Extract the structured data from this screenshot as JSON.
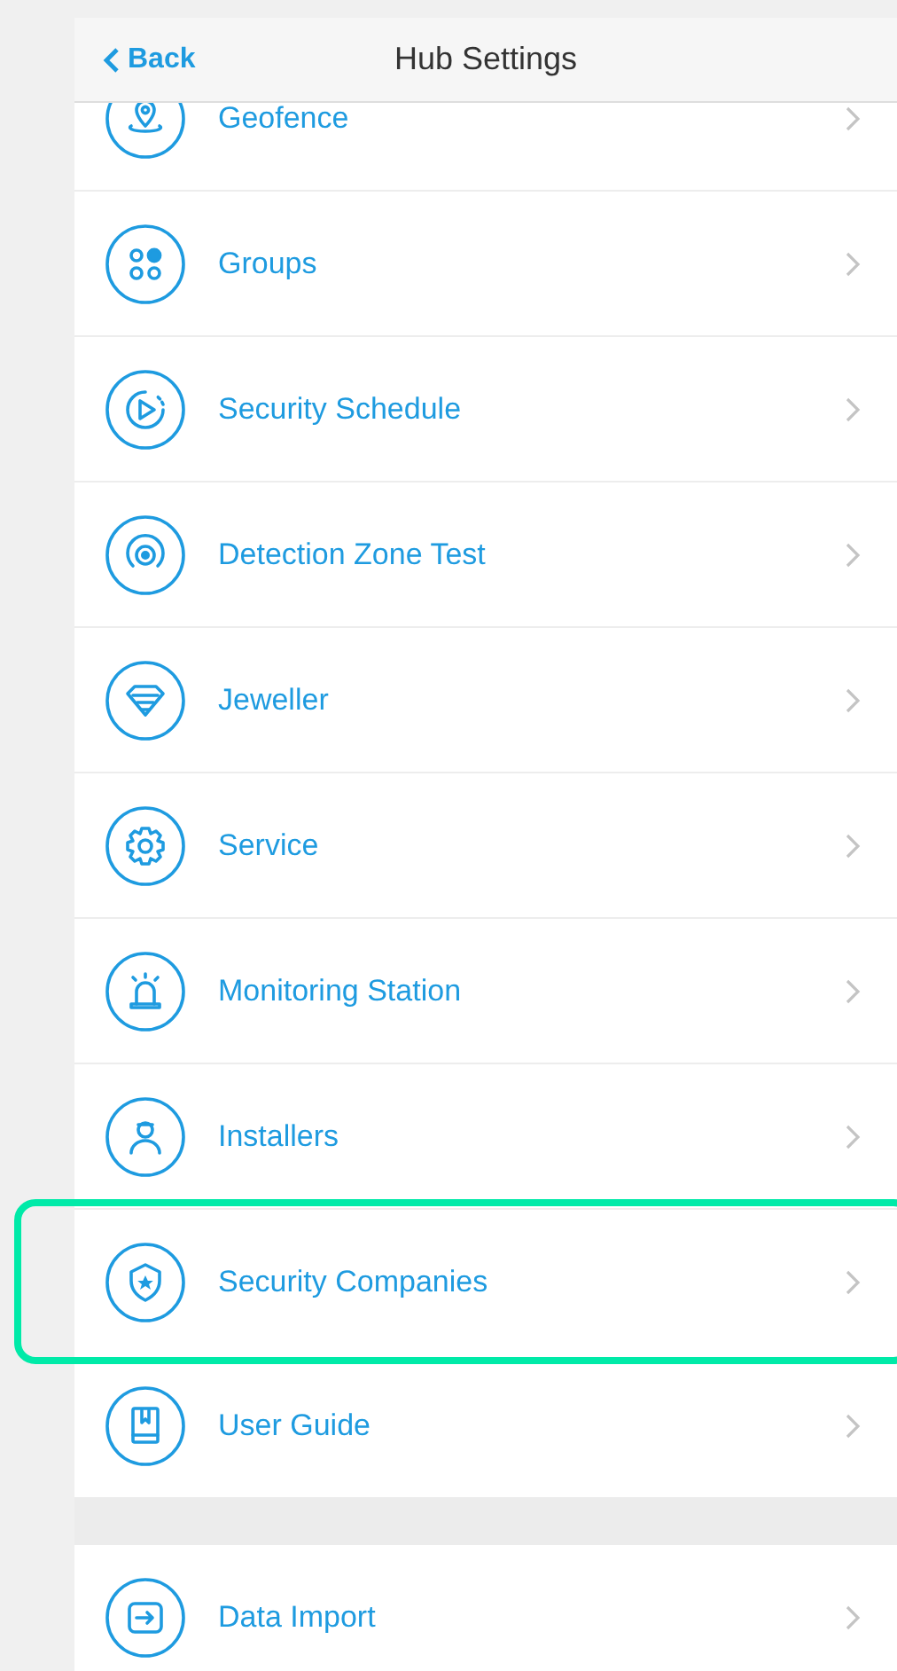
{
  "header": {
    "back": "Back",
    "title": "Hub Settings"
  },
  "sections": [
    {
      "items": [
        {
          "label": "Geofence",
          "kind": "pin",
          "highlighted": false
        },
        {
          "label": "Groups",
          "kind": "groups",
          "highlighted": false
        },
        {
          "label": "Security Schedule",
          "kind": "schedule",
          "highlighted": false
        },
        {
          "label": "Detection Zone Test",
          "kind": "zone",
          "highlighted": false
        },
        {
          "label": "Jeweller",
          "kind": "jeweller",
          "highlighted": false
        },
        {
          "label": "Service",
          "kind": "gear",
          "highlighted": false
        },
        {
          "label": "Monitoring Station",
          "kind": "siren",
          "highlighted": false
        },
        {
          "label": "Installers",
          "kind": "person",
          "highlighted": false
        },
        {
          "label": "Security Companies",
          "kind": "shield",
          "highlighted": true
        },
        {
          "label": "User Guide",
          "kind": "book",
          "highlighted": false
        }
      ]
    },
    {
      "items": [
        {
          "label": "Data Import",
          "kind": "import",
          "highlighted": false
        }
      ]
    }
  ]
}
